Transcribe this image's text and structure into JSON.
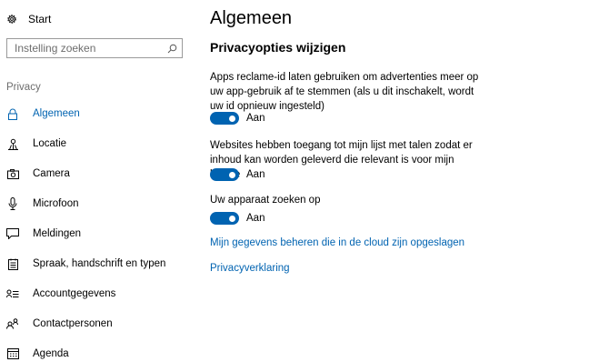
{
  "sidebar": {
    "start_label": "Start",
    "search": {
      "placeholder": "Instelling zoeken",
      "value": ""
    },
    "section_label": "Privacy",
    "items": [
      {
        "label": "Algemeen",
        "icon": "lock-icon",
        "active": true
      },
      {
        "label": "Locatie",
        "icon": "location-icon",
        "active": false
      },
      {
        "label": "Camera",
        "icon": "camera-icon",
        "active": false
      },
      {
        "label": "Microfoon",
        "icon": "microphone-icon",
        "active": false
      },
      {
        "label": "Meldingen",
        "icon": "notification-icon",
        "active": false
      },
      {
        "label": "Spraak, handschrift en typen",
        "icon": "speech-icon",
        "active": false
      },
      {
        "label": "Accountgegevens",
        "icon": "account-info-icon",
        "active": false
      },
      {
        "label": "Contactpersonen",
        "icon": "contacts-icon",
        "active": false
      },
      {
        "label": "Agenda",
        "icon": "calendar-icon",
        "active": false
      }
    ]
  },
  "main": {
    "title": "Algemeen",
    "section_title": "Privacyopties wijzigen",
    "settings": [
      {
        "description": "Apps reclame-id laten gebruiken om advertenties meer op uw app-gebruik af te stemmen (als u dit inschakelt, wordt uw id opnieuw ingesteld)",
        "state": "Aan",
        "on": true
      },
      {
        "description": "Websites hebben toegang tot mijn lijst met talen zodat er inhoud kan worden geleverd die relevant is voor mijn locatie",
        "state": "Aan",
        "on": true
      },
      {
        "description": "Uw apparaat zoeken op",
        "state": "Aan",
        "on": true
      }
    ],
    "links": [
      "Mijn gegevens beheren die in de cloud zijn opgeslagen",
      "Privacyverklaring"
    ]
  },
  "colors": {
    "accent": "#0063b1",
    "secondary_text": "#6d6d6d",
    "background": "#ffffff"
  }
}
